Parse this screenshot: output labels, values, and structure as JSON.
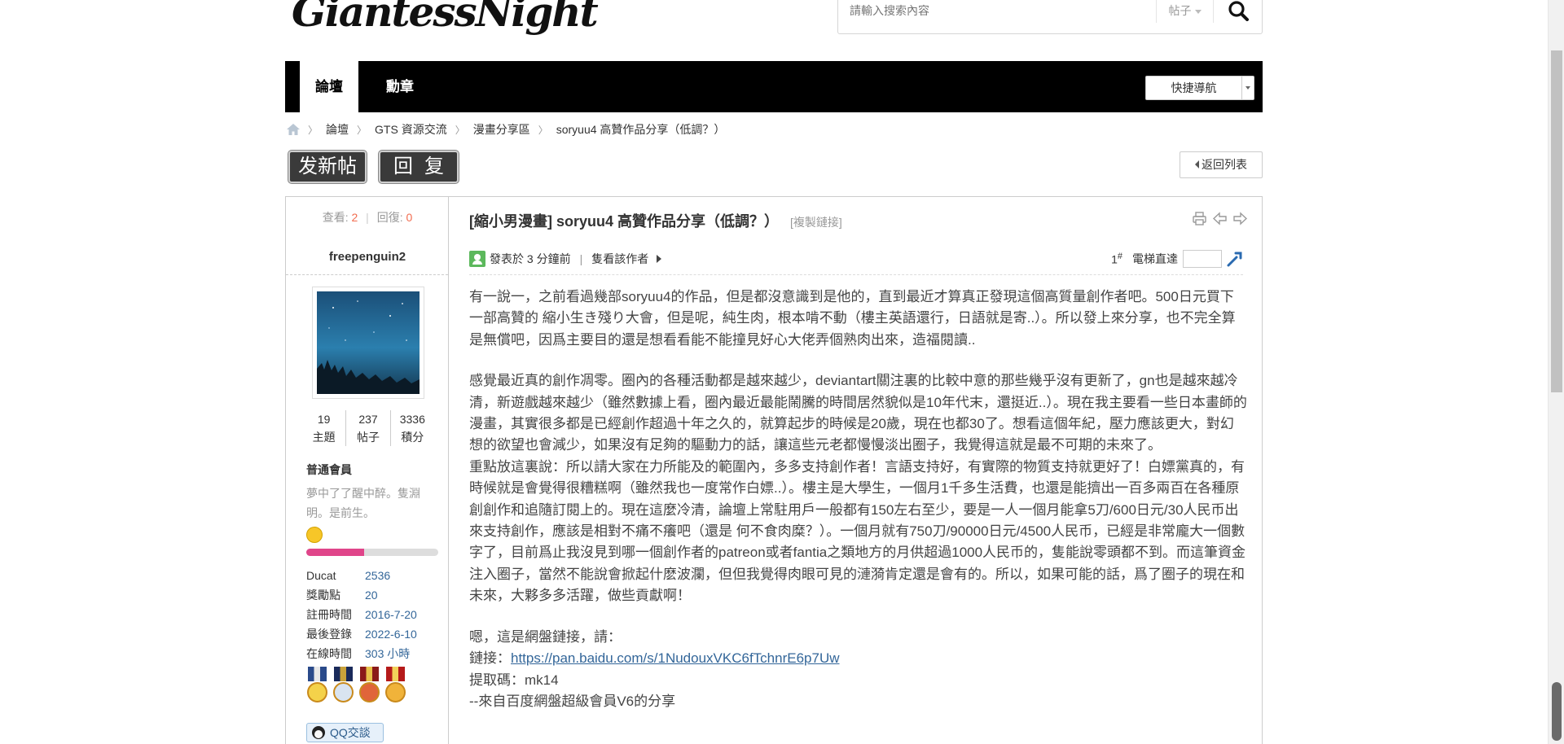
{
  "header": {
    "logo_text": "GiantessNight",
    "search_placeholder": "請輸入搜索內容",
    "search_scope": "帖子"
  },
  "nav": {
    "tabs": [
      {
        "label": "論壇",
        "active": true
      },
      {
        "label": "勳章",
        "active": false
      }
    ],
    "quick_nav": "快捷導航"
  },
  "breadcrumb": {
    "home_icon": "home-icon",
    "items": [
      "論壇",
      "GTS 資源交流",
      "漫畫分享區",
      "soryuu4 高贊作品分享（低調？）"
    ]
  },
  "actions": {
    "new_post": "发新帖",
    "reply": "回复",
    "back_list": "返回列表"
  },
  "sidebar": {
    "views_label": "查看:",
    "views": "2",
    "replies_label": "回復:",
    "replies": "0",
    "author": "freepenguin2",
    "stats": [
      {
        "value": "19",
        "label": "主題"
      },
      {
        "value": "237",
        "label": "帖子"
      },
      {
        "value": "3336",
        "label": "積分"
      }
    ],
    "group": "普通會員",
    "signature": "夢中了了醒中醉。隻淵明。是前生。",
    "level_progress_percent": 44,
    "info": [
      {
        "k": "Ducat",
        "v": "2536"
      },
      {
        "k": "獎勵點",
        "v": "20"
      },
      {
        "k": "註冊時間",
        "v": "2016-7-20"
      },
      {
        "k": "最後登錄",
        "v": "2022-6-10"
      },
      {
        "k": "在線時間",
        "v": "303 小時"
      }
    ],
    "qq_label": "QQ交談"
  },
  "post": {
    "title": "[縮小男漫畫] soryuu4 高贊作品分享（低調？）",
    "copy_link": "[複製鏈接]",
    "posted": "發表於 3 分鐘前",
    "only_author": "隻看該作者",
    "floor_number": "1",
    "floor_mark": "#",
    "elevator_label": "電梯直達",
    "paragraphs": [
      "有一說一，之前看過幾部soryuu4的作品，但是都沒意識到是他的，直到最近才算真正發現這個高質量創作者吧。500日元買下一部高贊的 縮小生き殘り大會，但是呢，純生肉，根本啃不動（樓主英語還行，日語就是寄..）。所以發上來分享，也不完全算是無償吧，因爲主要目的還是想看看能不能撞見好心大佬弄個熟肉出來，造福閱讀..",
      "感覺最近真的創作凋零。圈內的各種活動都是越來越少，deviantart關注裏的比較中意的那些幾乎沒有更新了，gn也是越來越冷清，新遊戲越來越少（雖然數據上看，圈內最近最能鬧騰的時間居然貌似是10年代末，還挺近..）。現在我主要看一些日本畫師的漫畫，其實很多都是已經創作超過十年之久的，就算起步的時候是20歲，現在也都30了。想看這個年紀，壓力應該更大，對幻想的欲望也會減少，如果沒有足夠的驅動力的話，讓這些元老都慢慢淡出圈子，我覺得這就是最不可期的未來了。",
      "重點放這裏說：所以請大家在力所能及的範圍內，多多支持創作者！言語支持好，有實際的物質支持就更好了！白嫖黨真的，有時候就是會覺得很糟糕啊（雖然我也一度常作白嫖..）。樓主是大學生，一個月1千多生活費，也還是能擠出一百多兩百在各種原創創作和追隨訂閱上的。現在這麼冷清，論壇上常駐用戶一般都有150左右至少，要是一人一個月能拿5刀/600日元/30人民币出來支持創作，應該是相對不痛不癢吧（還是 何不食肉糜？）。一個月就有750刀/90000日元/4500人民币，已經是非常龐大一個數字了，目前爲止我沒見到哪一個創作者的patreon或者fantia之類地方的月供超過1000人民币的，隻能說零頭都不到。而這筆資金注入圈子，當然不能說會掀起什麽波瀾，但但我覺得肉眼可見的漣漪肯定還是會有的。所以，如果可能的話，爲了圈子的現在和未來，大夥多多活躍，做些貢獻啊！",
      "嗯，這是網盤鏈接，請："
    ],
    "link_label": "鏈接：",
    "link_url": "https://pan.baidu.com/s/1NudouxVKC6fTchnrE6p7Uw",
    "code_line": "提取碼：mk14",
    "share_line": "--來自百度網盤超級會員V6的分享"
  },
  "colors": {
    "accent": "#f26c4f",
    "link": "#336699",
    "nav_bg": "#000000",
    "progress": "#e0458a"
  }
}
